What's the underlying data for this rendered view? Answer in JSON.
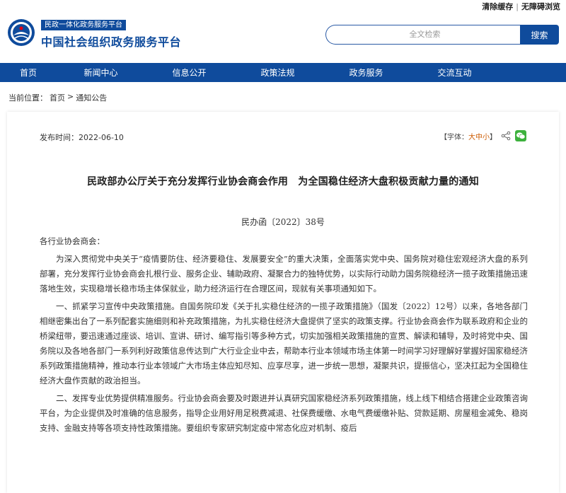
{
  "top_links": {
    "clear_cache": "清除缓存",
    "separator": "|",
    "accessibility": "无障碍浏览"
  },
  "header": {
    "logo_icon": "ministry-emblem-icon",
    "brand_tag": "民政一体化政务服务平台",
    "brand_name": "中国社会组织政务服务平台",
    "colors": {
      "primary": "#0f4b9c"
    }
  },
  "search": {
    "placeholder": "全文检索",
    "button_label": "搜索"
  },
  "nav": {
    "items": [
      {
        "label": "首页"
      },
      {
        "label": "新闻中心"
      },
      {
        "label": "信息公开"
      },
      {
        "label": "政策法规"
      },
      {
        "label": "政务服务"
      },
      {
        "label": "交流互动"
      }
    ]
  },
  "breadcrumb": {
    "prefix": "当前位置：",
    "home": "首页",
    "arrow": ">",
    "current": "通知公告"
  },
  "article": {
    "pubdate": "发布时间：2022-06-10",
    "font_label_open": "【字体：",
    "font_large": "大",
    "font_medium": "中",
    "font_small": "小",
    "font_label_close": "】",
    "share_icon": "share-icon",
    "wechat_icon": "wechat-icon",
    "title": "民政部办公厅关于充分发挥行业协会商会作用　为全国稳住经济大盘积极贡献力量的通知",
    "doc_number": "民办函〔2022〕38号",
    "salutation": "各行业协会商会：",
    "paragraphs": [
      "为深入贯彻党中央关于“疫情要防住、经济要稳住、发展要安全”的重大决策，全面落实党中央、国务院对稳住宏观经济大盘的系列部署，充分发挥行业协会商会扎根行业、服务企业、辅助政府、凝聚合力的独特优势，以实际行动助力国务院稳经济一揽子政策措施迅速落地生效，实现稳增长稳市场主体保就业，助力经济运行在合理区间，现就有关事项通知如下。",
      "一、抓紧学习宣传中央政策措施。自国务院印发《关于扎实稳住经济的一揽子政策措施》（国发〔2022〕12号）以来，各地各部门相继密集出台了一系列配套实施细则和补充政策措施，为扎实稳住经济大盘提供了坚实的政策支撑。行业协会商会作为联系政府和企业的桥梁纽带，要迅速通过座谈、培训、宣讲、研讨、编写指引等多种方式，切实加强相关政策措施的宣贯、解读和辅导，及时将党中央、国务院以及各地各部门一系列利好政策信息传达到广大行业企业中去，帮助本行业本领域市场主体第一时间学习好理解好掌握好国家稳经济系列政策措施精神，推动本行业本领域广大市场主体应知尽知、应享尽享，进一步统一思想，凝聚共识，提振信心，坚决扛起为全国稳住经济大盘作贡献的政治担当。",
      "二、发挥专业优势提供精准服务。行业协会商会要及时跟进并认真研究国家稳经济系列政策措施，线上线下相结合搭建企业政策咨询平台，为企业提供及时准确的信息服务，指导企业用好用足税费减退、社保费缓缴、水电气费缓缴补贴、贷款延期、房屋租金减免、稳岗支持、金融支持等各项支持性政策措施。要组织专家研究制定疫中常态化应对机制、疫后"
    ]
  }
}
